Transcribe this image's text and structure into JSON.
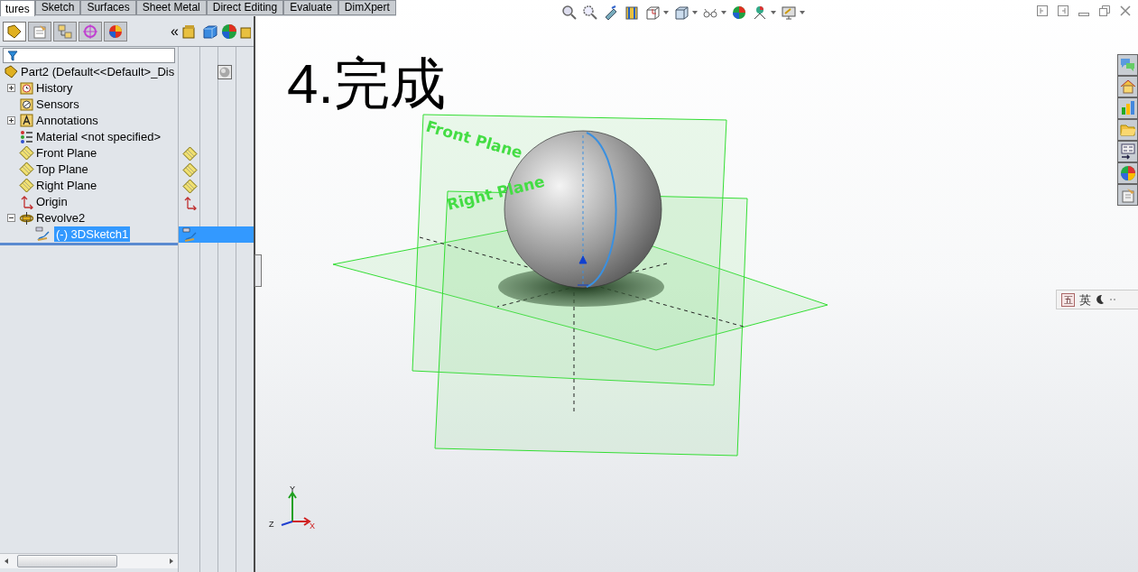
{
  "command_tabs": [
    {
      "label": "tures",
      "selected": true
    },
    {
      "label": "Sketch",
      "selected": false
    },
    {
      "label": "Surfaces",
      "selected": false
    },
    {
      "label": "Sheet Metal",
      "selected": false
    },
    {
      "label": "Direct Editing",
      "selected": false
    },
    {
      "label": "Evaluate",
      "selected": false
    },
    {
      "label": "DimXpert",
      "selected": false
    }
  ],
  "manager_tabs": [
    {
      "selected": true
    },
    {
      "selected": false
    },
    {
      "selected": false
    },
    {
      "selected": false
    },
    {
      "selected": false
    }
  ],
  "collapse_label": "«",
  "feature_tree": {
    "label": "Part2  (Default<<Default>_Dis",
    "children": [
      {
        "label": "History",
        "kind": "history",
        "expanded": false,
        "selected": false
      },
      {
        "label": "Sensors",
        "kind": "sensors",
        "selected": false
      },
      {
        "label": "Annotations",
        "kind": "annotations",
        "expanded": false,
        "selected": false
      },
      {
        "label": "Material <not specified>",
        "kind": "material",
        "selected": false
      },
      {
        "label": "Front Plane",
        "kind": "plane",
        "selected": false
      },
      {
        "label": "Top Plane",
        "kind": "plane",
        "selected": false
      },
      {
        "label": "Right Plane",
        "kind": "plane",
        "selected": false
      },
      {
        "label": "Origin",
        "kind": "origin",
        "selected": false
      },
      {
        "label": "Revolve2",
        "kind": "revolve",
        "expanded": true,
        "selected": false,
        "children": [
          {
            "label": "(-) 3DSketch1",
            "kind": "sketch",
            "selected": true
          }
        ]
      }
    ]
  },
  "viewport": {
    "caption": "4.完成",
    "plane_labels": [
      "Front Plane",
      "Right Plane"
    ],
    "axis_labels": [
      "Y",
      "Z",
      "X"
    ]
  },
  "ime_bar": {
    "mode_icon": "五",
    "language": "英"
  }
}
